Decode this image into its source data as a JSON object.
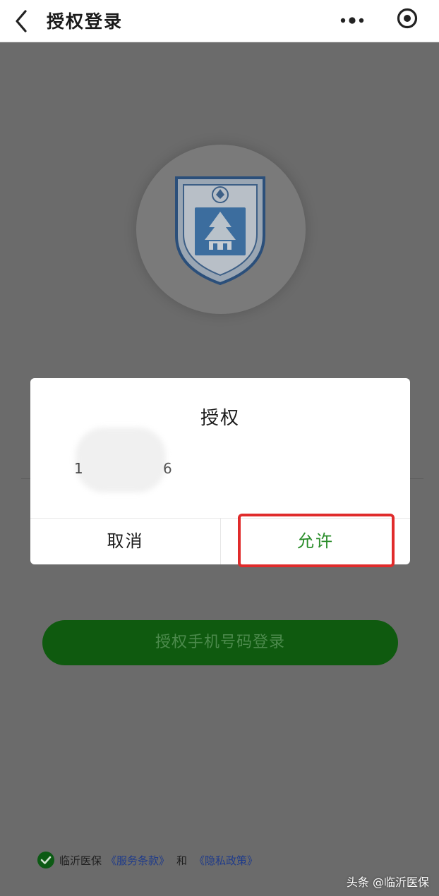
{
  "navbar": {
    "title": "授权登录",
    "back_icon": "chevron-left-icon",
    "more_icon": "more-dots-icon",
    "close_icon": "target-close-icon"
  },
  "background": {
    "login_button_label": "授权手机号码登录",
    "agreement": {
      "org": "临沂医保",
      "terms_link": "《服务条款》",
      "and_text": "和",
      "privacy_link": "《隐私政策》"
    }
  },
  "dialog": {
    "title": "授权",
    "phone_visible_start": "1",
    "phone_visible_end": "6",
    "cancel_label": "取消",
    "allow_label": "允许"
  },
  "watermark": "头条 @临沂医保",
  "colors": {
    "accent_green": "#2a8d2a",
    "button_green": "#0f5a0f",
    "highlight_red": "#e02b2b",
    "overlay_gray": "#6b6b6b"
  }
}
